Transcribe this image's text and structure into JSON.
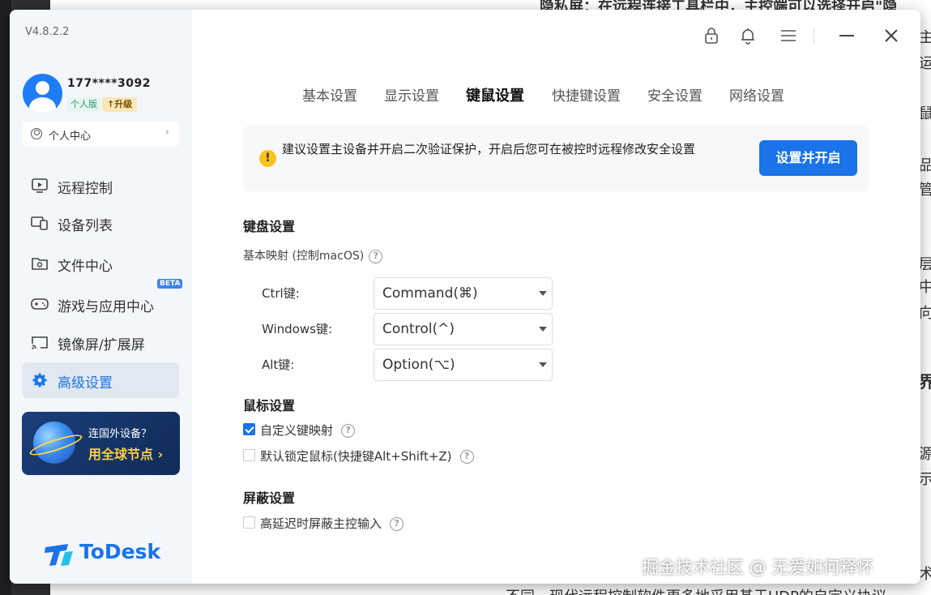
{
  "background": {
    "right_fragments": [
      "隐私屏：在远程连接工具栏中，主控端可以选择开启\"隐",
      "主",
      "运",
      "鼠",
      "品",
      "管",
      "层",
      "中",
      "向",
      "界",
      "源",
      "示",
      "不同。现代远程控制软件更多地采用基于UDP的自定义协议",
      "术"
    ]
  },
  "app": {
    "version": "V4.8.2.2",
    "user": {
      "name": "177****3092",
      "plan_badge": "个人版",
      "upgrade_badge": "升级"
    },
    "personal_center": "个人中心",
    "nav": [
      {
        "label": "远程控制",
        "icon": "remote-control-icon"
      },
      {
        "label": "设备列表",
        "icon": "device-list-icon"
      },
      {
        "label": "文件中心",
        "icon": "folder-icon"
      },
      {
        "label": "游戏与应用中心",
        "icon": "gamepad-icon"
      },
      {
        "label": "镜像屏/扩展屏",
        "icon": "screen-cast-icon"
      },
      {
        "label": "高级设置",
        "icon": "gear-icon",
        "active": true
      }
    ],
    "beta_badge": "BETA",
    "promo": {
      "line1": "连国外设备？",
      "line2": "用全球节点 ›"
    },
    "logo_text": "ToDesk"
  },
  "tabs": [
    "基本设置",
    "显示设置",
    "键鼠设置",
    "快捷键设置",
    "安全设置",
    "网络设置"
  ],
  "active_tab": "键鼠设置",
  "alert": {
    "message": "建议设置主设备并开启二次验证保护，开启后您可在被控时远程修改安全设置",
    "button": "设置并开启"
  },
  "keyboard": {
    "title": "键盘设置",
    "mapping_label": "基本映射 (控制macOS)",
    "rows": [
      {
        "label": "Ctrl键:",
        "value": "Command(⌘)"
      },
      {
        "label": "Windows键:",
        "value": "Control(^)"
      },
      {
        "label": "Alt键:",
        "value": "Option(⌥)"
      }
    ]
  },
  "mouse": {
    "title": "鼠标设置",
    "options": [
      {
        "label": "自定义键映射",
        "checked": true
      },
      {
        "label": "默认锁定鼠标(快捷键Alt+Shift+Z)",
        "checked": false
      }
    ]
  },
  "shield": {
    "title": "屏蔽设置",
    "options": [
      {
        "label": "高延迟时屏蔽主控输入",
        "checked": false
      }
    ]
  },
  "watermark": "掘金技术社区 @ 无爱如何释怀"
}
